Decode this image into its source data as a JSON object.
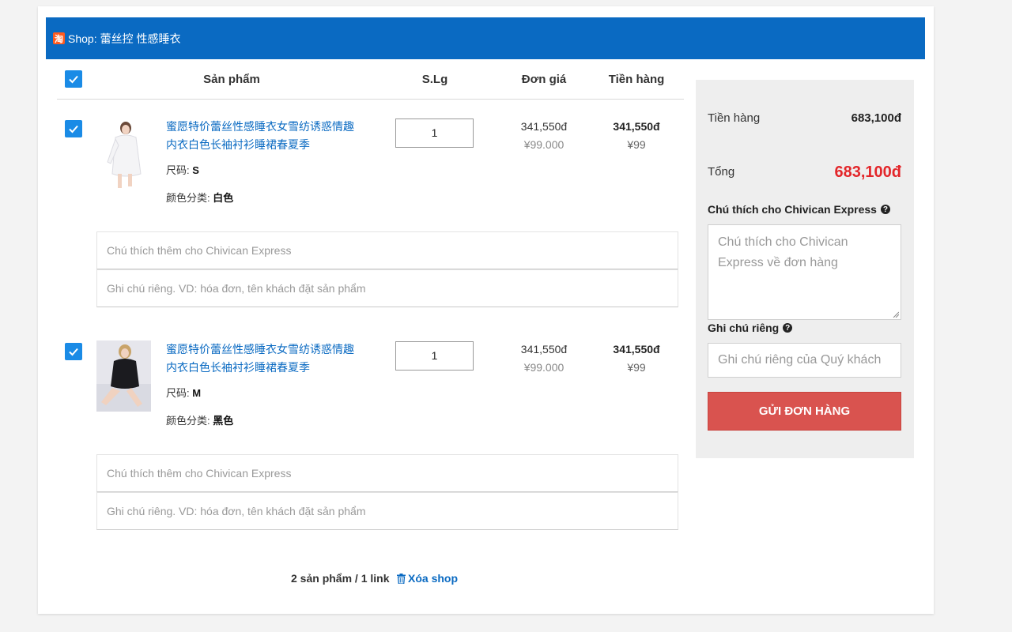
{
  "shop": {
    "icon_glyph": "淘",
    "label": "Shop:",
    "name": "蕾丝控 性感睡衣"
  },
  "table": {
    "headers": {
      "product": "Sản phẩm",
      "qty": "S.Lg",
      "unit_price": "Đơn giá",
      "total": "Tiền hàng"
    }
  },
  "items": [
    {
      "title_line1": "蜜愿特价蕾丝性感睡衣女雪纺诱惑情趣",
      "title_line2": "内衣白色长袖衬衫睡裙春夏季",
      "size_label": "尺码:",
      "size_value": "S",
      "color_label": "颜色分类:",
      "color_value": "白色",
      "qty": "1",
      "unit_price_vnd": "341,550đ",
      "unit_price_cny": "¥99.000",
      "total_vnd": "341,550đ",
      "total_cny": "¥99",
      "note_placeholder": "Chú thích thêm cho Chivican Express",
      "private_placeholder": "Ghi chú riêng. VD: hóa đơn, tên khách đặt sản phẩm"
    },
    {
      "title_line1": "蜜愿特价蕾丝性感睡衣女雪纺诱惑情趣",
      "title_line2": "内衣白色长袖衬衫睡裙春夏季",
      "size_label": "尺码:",
      "size_value": "M",
      "color_label": "颜色分类:",
      "color_value": "黑色",
      "qty": "1",
      "unit_price_vnd": "341,550đ",
      "unit_price_cny": "¥99.000",
      "total_vnd": "341,550đ",
      "total_cny": "¥99",
      "note_placeholder": "Chú thích thêm cho Chivican Express",
      "private_placeholder": "Ghi chú riêng. VD: hóa đơn, tên khách đặt sản phẩm"
    }
  ],
  "footer": {
    "count_text": "2 sản phẩm / 1 link",
    "delete_label": "Xóa shop"
  },
  "summary": {
    "subtotal_label": "Tiền hàng",
    "subtotal_value": "683,100đ",
    "total_label": "Tổng",
    "total_value": "683,100đ",
    "note_section_label": "Chú thích cho Chivican Express",
    "note_placeholder": "Chú thích cho Chivican Express về đơn hàng",
    "private_section_label": "Ghi chú riêng",
    "private_placeholder": "Ghi chú riêng của Quý khách",
    "submit_label": "GỬI ĐƠN HÀNG"
  },
  "colors": {
    "header_blue": "#0a6ac2",
    "checkbox_blue": "#1a8be6",
    "total_red": "#e3262a",
    "submit_red": "#d9534f"
  }
}
